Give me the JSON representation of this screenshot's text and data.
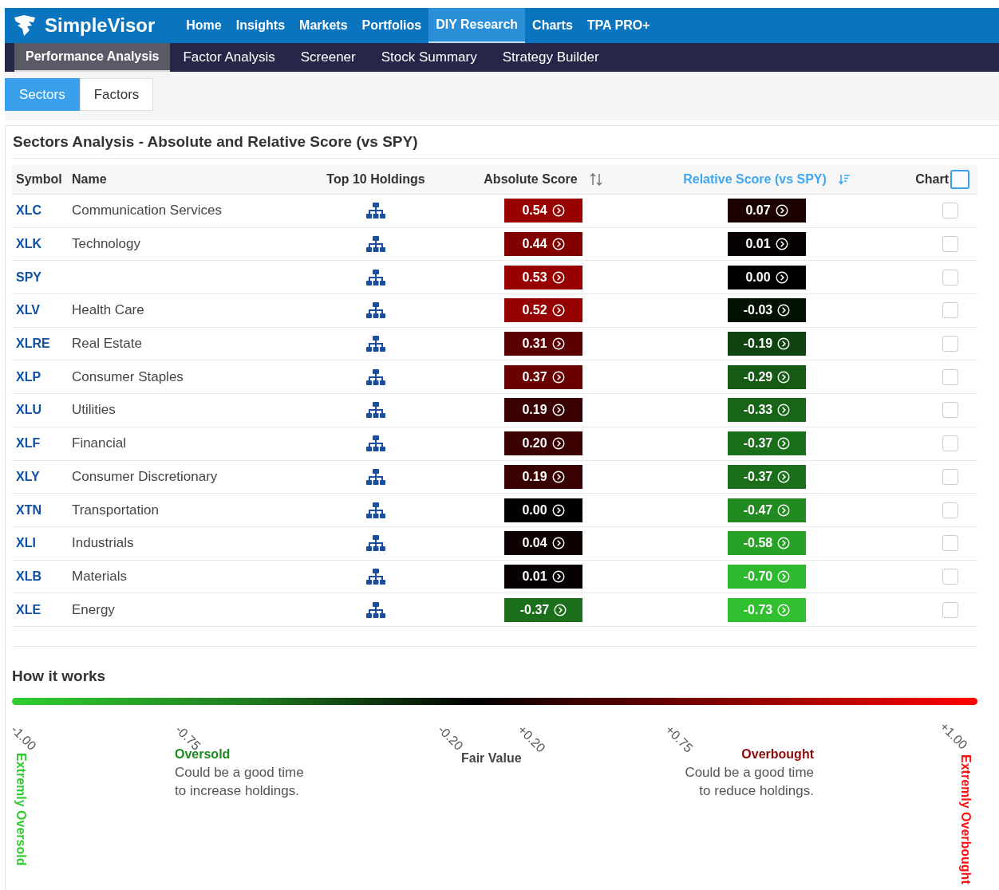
{
  "brand": {
    "name": "SimpleVisor"
  },
  "nav": [
    {
      "label": "Home",
      "selected": false
    },
    {
      "label": "Insights",
      "selected": false
    },
    {
      "label": "Markets",
      "selected": false
    },
    {
      "label": "Portfolios",
      "selected": false
    },
    {
      "label": "DIY Research",
      "selected": true
    },
    {
      "label": "Charts",
      "selected": false
    },
    {
      "label": "TPA PRO+",
      "selected": false
    }
  ],
  "subnav": [
    {
      "label": "Performance Analysis",
      "selected": true
    },
    {
      "label": "Factor Analysis",
      "selected": false
    },
    {
      "label": "Screener",
      "selected": false
    },
    {
      "label": "Stock Summary",
      "selected": false
    },
    {
      "label": "Strategy Builder",
      "selected": false
    }
  ],
  "tabs": [
    {
      "label": "Sectors",
      "selected": true
    },
    {
      "label": "Factors",
      "selected": false
    }
  ],
  "panel": {
    "title": "Sectors Analysis - Absolute and Relative Score (vs SPY)"
  },
  "table": {
    "select_all_checked": false,
    "columns": [
      {
        "label": "Symbol",
        "kind": "text",
        "sorted": false
      },
      {
        "label": "Name",
        "kind": "text",
        "sorted": false
      },
      {
        "label": "Top 10 Holdings",
        "kind": "center",
        "sorted": false
      },
      {
        "label": "Absolute Score",
        "kind": "sort",
        "sorted": false
      },
      {
        "label": "Relative Score (vs SPY)",
        "kind": "sort",
        "sorted": true
      },
      {
        "label": "Chart",
        "kind": "check",
        "sorted": false
      }
    ],
    "rows": [
      {
        "symbol": "XLC",
        "name": "Communication Services",
        "absolute": {
          "value": "0.54",
          "color": "#990000"
        },
        "relative": {
          "value": "0.07",
          "color": "#1c0000"
        },
        "checked": false
      },
      {
        "symbol": "XLK",
        "name": "Technology",
        "absolute": {
          "value": "0.44",
          "color": "#820000"
        },
        "relative": {
          "value": "0.01",
          "color": "#060000"
        },
        "checked": false
      },
      {
        "symbol": "SPY",
        "name": "",
        "absolute": {
          "value": "0.53",
          "color": "#970000"
        },
        "relative": {
          "value": "0.00",
          "color": "#000000"
        },
        "checked": false
      },
      {
        "symbol": "XLV",
        "name": "Health Care",
        "absolute": {
          "value": "0.52",
          "color": "#950000"
        },
        "relative": {
          "value": "-0.03",
          "color": "#041204"
        },
        "checked": false
      },
      {
        "symbol": "XLRE",
        "name": "Real Estate",
        "absolute": {
          "value": "0.31",
          "color": "#5a0000"
        },
        "relative": {
          "value": "-0.19",
          "color": "#0f430f"
        },
        "checked": false
      },
      {
        "symbol": "XLP",
        "name": "Consumer Staples",
        "absolute": {
          "value": "0.37",
          "color": "#6b0000"
        },
        "relative": {
          "value": "-0.29",
          "color": "#155b15"
        },
        "checked": false
      },
      {
        "symbol": "XLU",
        "name": "Utilities",
        "absolute": {
          "value": "0.19",
          "color": "#380000"
        },
        "relative": {
          "value": "-0.33",
          "color": "#186518"
        },
        "checked": false
      },
      {
        "symbol": "XLF",
        "name": "Financial",
        "absolute": {
          "value": "0.20",
          "color": "#3b0000"
        },
        "relative": {
          "value": "-0.37",
          "color": "#1b6f1b"
        },
        "checked": false
      },
      {
        "symbol": "XLY",
        "name": "Consumer Discretionary",
        "absolute": {
          "value": "0.19",
          "color": "#380000"
        },
        "relative": {
          "value": "-0.37",
          "color": "#1b6f1b"
        },
        "checked": false
      },
      {
        "symbol": "XTN",
        "name": "Transportation",
        "absolute": {
          "value": "0.00",
          "color": "#000000"
        },
        "relative": {
          "value": "-0.47",
          "color": "#218a21"
        },
        "checked": false
      },
      {
        "symbol": "XLI",
        "name": "Industrials",
        "absolute": {
          "value": "0.04",
          "color": "#0c0000"
        },
        "relative": {
          "value": "-0.58",
          "color": "#27a227"
        },
        "checked": false
      },
      {
        "symbol": "XLB",
        "name": "Materials",
        "absolute": {
          "value": "0.01",
          "color": "#060000"
        },
        "relative": {
          "value": "-0.70",
          "color": "#2eba2e"
        },
        "checked": false
      },
      {
        "symbol": "XLE",
        "name": "Energy",
        "absolute": {
          "value": "-0.37",
          "color": "#1b6f1b"
        },
        "relative": {
          "value": "-0.73",
          "color": "#30c030"
        },
        "checked": false
      }
    ]
  },
  "how_it_works": {
    "title": "How it works",
    "ticks": [
      "-1.00",
      "-0.75",
      "-0.20",
      "+0.20",
      "+0.75",
      "+1.00"
    ],
    "extreme_low": "Extremly Oversold",
    "extreme_high": "Extremly Overbought",
    "oversold": {
      "title": "Oversold",
      "lines": [
        "Could be a good time",
        "to increase holdings."
      ]
    },
    "fair_value": "Fair Value",
    "overbought": {
      "title": "Overbought",
      "lines": [
        "Could be a good time",
        "to reduce holdings."
      ]
    }
  }
}
